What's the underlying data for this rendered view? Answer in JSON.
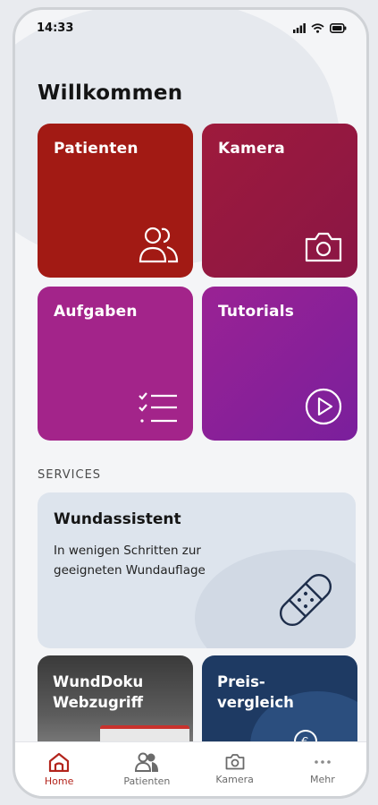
{
  "status": {
    "time": "14:33"
  },
  "header": {
    "title": "Willkommen"
  },
  "tiles": [
    {
      "label": "Patienten",
      "icon": "users-icon"
    },
    {
      "label": "Kamera",
      "icon": "camera-icon"
    },
    {
      "label": "Aufgaben",
      "icon": "checklist-icon"
    },
    {
      "label": "Tutorials",
      "icon": "play-circle-icon"
    }
  ],
  "services": {
    "heading": "SERVICES",
    "wundassistent": {
      "title": "Wundassistent",
      "description": "In wenigen Schritten zur geeigneten Wundauflage"
    },
    "cards": [
      {
        "title": "WundDoku Webzugriff"
      },
      {
        "title": "Preis-vergleich"
      }
    ]
  },
  "nav": [
    {
      "label": "Home",
      "active": true
    },
    {
      "label": "Patienten"
    },
    {
      "label": "Kamera"
    },
    {
      "label": "Mehr"
    }
  ],
  "colors": {
    "accent": "#b3241c"
  }
}
